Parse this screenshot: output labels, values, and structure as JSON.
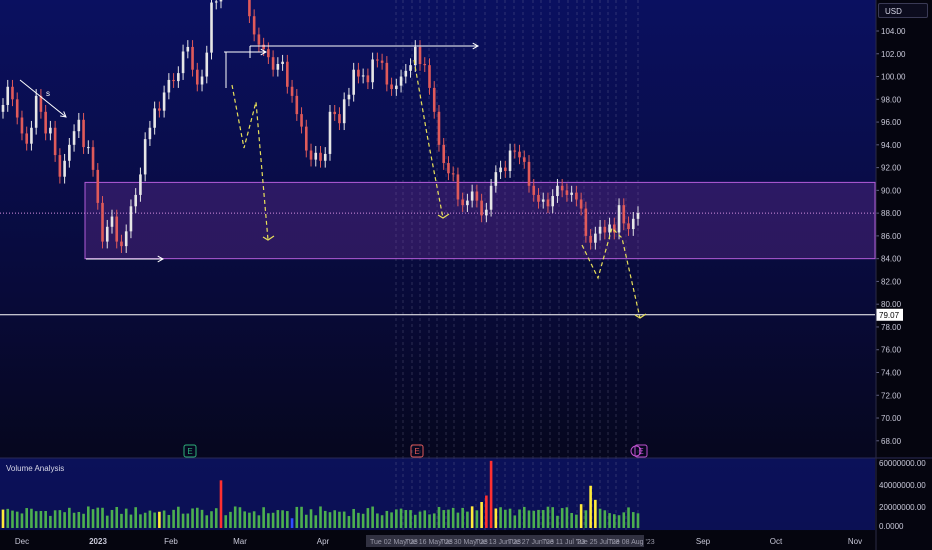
{
  "toolbar": {
    "currency": "USD"
  },
  "volume_pane": {
    "title": "Volume Analysis"
  },
  "colors": {
    "background_top": "#0a1060",
    "background_bottom": "#05050f",
    "up_candle": "#e6e6e6",
    "down_candle": "#e05a5a",
    "zone_fill": "#8a3cb0",
    "projection": "#e8e05a",
    "volume_normal": "#4caf50",
    "volume_high": "#ffeb3b",
    "volume_extreme": "#ff3030",
    "volume_low": "#3050ff"
  },
  "chart_data": [
    {
      "type": "candlestick",
      "pane": "price",
      "y_range": [
        66,
        107
      ],
      "y_ticks": [
        "104.00",
        "102.00",
        "100.00",
        "98.00",
        "96.00",
        "94.00",
        "92.00",
        "90.00",
        "88.00",
        "86.00",
        "84.00",
        "82.00",
        "80.00",
        "78.00",
        "76.00",
        "74.00",
        "72.00",
        "70.00",
        "68.00"
      ],
      "x_ticks": [
        "Dec",
        "2023",
        "Feb",
        "Mar",
        "Apr",
        "Sep",
        "Oct",
        "Nov"
      ],
      "date_ticks": [
        "Tue 02 May '23",
        "Tue 16 May '23",
        "Tue 30 May '23",
        "Tue 13 Jun '23",
        "Tue 27 Jun '23",
        "Tue 11 Jul '23",
        "Tue 25 Jul '23",
        "Tue 08 Aug '23"
      ],
      "price_label": "79.07",
      "horizontal_line": 79.07,
      "dotted_price_line": 88.0,
      "zone": {
        "top": 90.7,
        "bottom": 84.0
      },
      "earnings_markers": [
        "E",
        "E",
        "E"
      ],
      "annotation": "s",
      "closes": [
        97.5,
        99.1,
        98.0,
        96.4,
        95.0,
        94.1,
        95.5,
        98.3,
        96.9,
        95.0,
        95.5,
        93.1,
        91.2,
        92.6,
        94.0,
        95.2,
        96.2,
        93.8,
        93.8,
        91.8,
        88.9,
        85.5,
        86.8,
        87.7,
        85.5,
        85.1,
        86.4,
        88.6,
        89.6,
        91.4,
        94.5,
        95.5,
        97.2,
        97.0,
        98.6,
        99.7,
        99.6,
        100.3,
        102.2,
        102.6,
        100.6,
        99.3,
        100.0,
        102.1,
        106.5,
        106.6,
        107.7,
        109.8,
        109.4,
        107.9,
        108.8,
        107.7,
        105.3,
        103.7,
        102.8,
        102.4,
        101.7,
        100.6,
        101.1,
        101.3,
        99.1,
        98.3,
        96.7,
        95.6,
        93.5,
        92.7,
        93.3,
        92.6,
        93.2,
        96.9,
        96.7,
        95.9,
        98.0,
        98.4,
        100.6,
        100.0,
        100.1,
        99.5,
        101.5,
        101.4,
        101.2,
        99.3,
        98.9,
        99.2,
        100.0,
        100.5,
        101.0,
        102.6,
        101.1,
        101.0,
        99.0,
        96.9,
        94.0,
        92.4,
        91.5,
        91.4,
        89.2,
        88.7,
        89.1,
        89.9,
        89.1,
        87.8,
        88.3,
        90.4,
        91.6,
        92.0,
        91.7,
        93.5,
        93.4,
        92.9,
        92.5,
        90.4,
        89.6,
        89.0,
        89.2,
        88.6,
        89.5,
        90.4,
        90.0,
        89.6,
        89.8,
        89.2,
        88.4,
        86.0,
        85.4,
        86.2,
        86.8,
        86.3,
        87.0,
        86.3,
        88.7,
        87.1,
        86.6,
        87.5,
        88.0
      ],
      "volume": {
        "y_range": [
          0,
          60000000
        ],
        "y_ticks": [
          "60000000.00",
          "40000000.00",
          "20000000.00",
          "0.0000"
        ]
      },
      "projections": [
        {
          "from": 97.0,
          "to": 85.5
        },
        {
          "from": 103.0,
          "to": 87.5
        },
        {
          "from": 88.0,
          "to": 78.8
        }
      ]
    }
  ]
}
